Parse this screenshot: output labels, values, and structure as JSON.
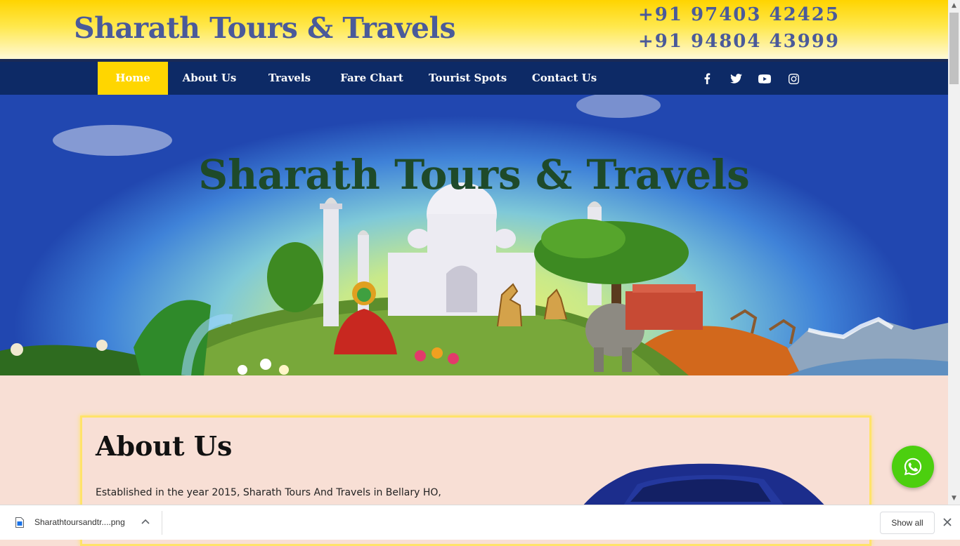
{
  "header": {
    "brand": "Sharath Tours & Travels",
    "phone_1": "+91 97403 42425",
    "phone_2": "+91 94804 43999"
  },
  "nav": {
    "items": [
      {
        "label": "Home",
        "active": true
      },
      {
        "label": "About Us"
      },
      {
        "label": "Travels"
      },
      {
        "label": "Fare Chart"
      },
      {
        "label": "Tourist Spots"
      },
      {
        "label": "Contact Us"
      }
    ],
    "social_icons": [
      "facebook-icon",
      "twitter-icon",
      "youtube-icon",
      "instagram-icon"
    ]
  },
  "hero": {
    "title": "Sharath Tours & Travels"
  },
  "about": {
    "heading": "About Us",
    "text": "Established in the year 2015, Sharath Tours And Travels in Bellary HO,"
  },
  "downloads": {
    "filename": "Sharathtoursandtr....png",
    "show_all": "Show all"
  },
  "colors": {
    "brand_text": "#4a5a9a",
    "nav_bg": "#0d2a66",
    "nav_active": "#ffd600",
    "about_bg": "#f8dfd5",
    "whatsapp": "#4ccf0f"
  }
}
